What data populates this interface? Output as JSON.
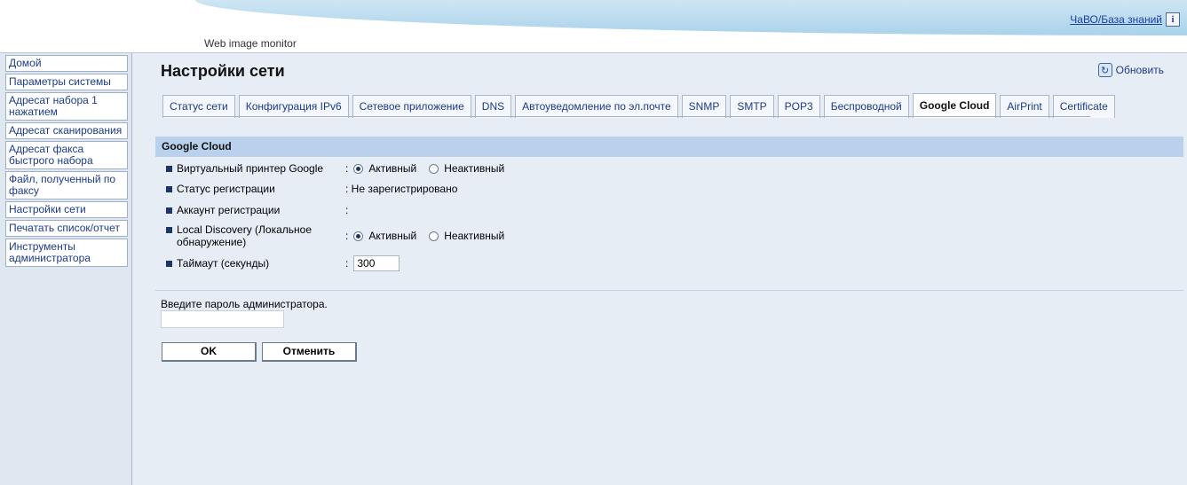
{
  "header": {
    "faq_link": "ЧаВО/База знаний",
    "info_icon": "i",
    "monitor_title": "Web image monitor"
  },
  "sidebar": {
    "items": [
      {
        "label": "Домой"
      },
      {
        "label": "Параметры системы"
      },
      {
        "label": "Адресат набора 1 нажатием"
      },
      {
        "label": "Адресат сканирования"
      },
      {
        "label": "Адресат факса быстрого набора"
      },
      {
        "label": "Файл, полученный по факсу"
      },
      {
        "label": "Настройки сети"
      },
      {
        "label": "Печатать список/отчет"
      },
      {
        "label": "Инструменты администратора"
      }
    ]
  },
  "main": {
    "title": "Настройки сети",
    "refresh_label": "Обновить",
    "tabs": [
      {
        "label": "Статус сети"
      },
      {
        "label": "Конфигурация IPv6"
      },
      {
        "label": "Сетевое приложение"
      },
      {
        "label": "DNS"
      },
      {
        "label": "Автоуведомление по эл.почте"
      },
      {
        "label": "SNMP"
      },
      {
        "label": "SMTP"
      },
      {
        "label": "POP3"
      },
      {
        "label": "Беспроводной"
      },
      {
        "label": "Google Cloud",
        "active": true
      },
      {
        "label": "AirPrint"
      },
      {
        "label": "Certificate"
      }
    ],
    "section_title": "Google Cloud",
    "fields": {
      "virtual_printer": {
        "label": "Виртуальный принтер Google",
        "option_active": "Активный",
        "option_inactive": "Неактивный",
        "selected": "Активный"
      },
      "reg_status": {
        "label": "Статус регистрации",
        "value": ": Не зарегистрировано"
      },
      "reg_account": {
        "label": "Аккаунт регистрации",
        "value": ":"
      },
      "local_discovery": {
        "label": "Local Discovery (Локальное обнаружение)",
        "option_active": "Активный",
        "option_inactive": "Неактивный",
        "selected": "Активный"
      },
      "timeout": {
        "label": "Таймаут (секунды)",
        "value": "300"
      }
    },
    "password_prompt": "Введите пароль администратора.",
    "ok_label": "OK",
    "cancel_label": "Отменить"
  }
}
